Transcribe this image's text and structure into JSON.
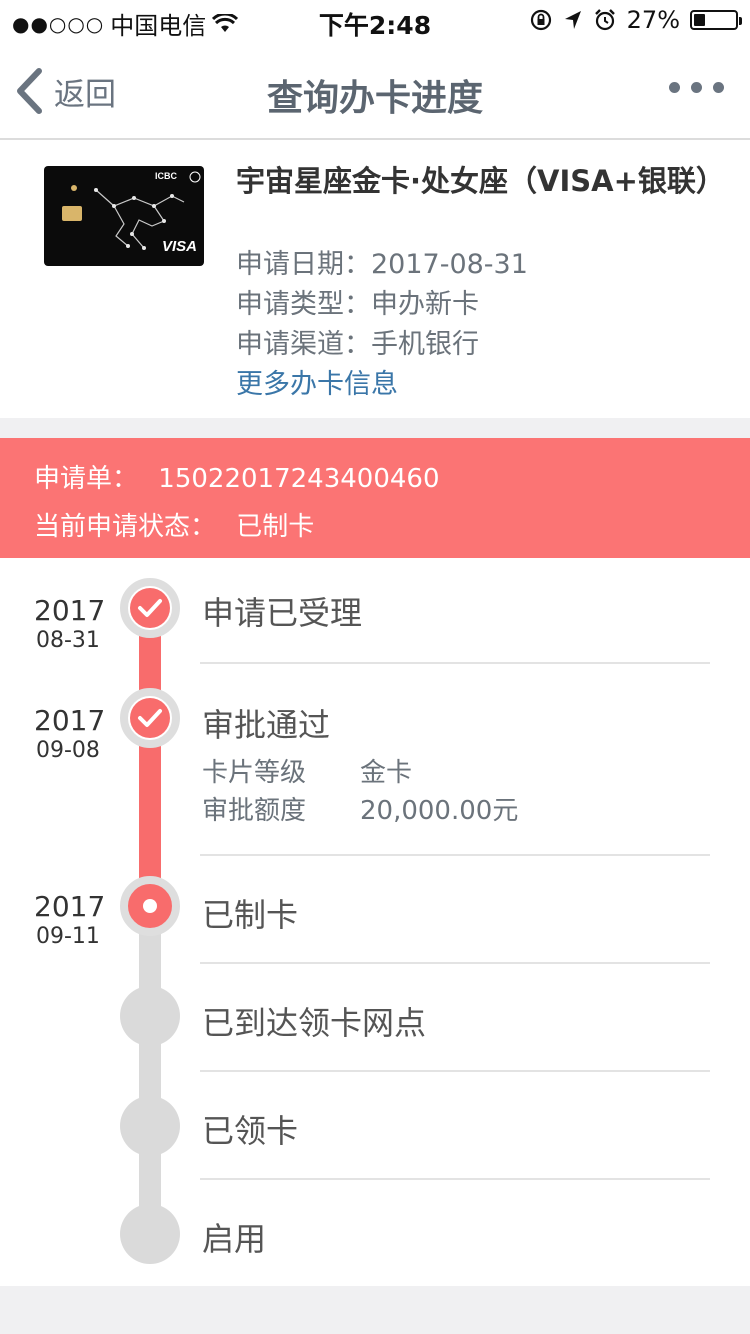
{
  "status_bar": {
    "signal": "●●○○○",
    "carrier": "中国电信",
    "time": "下午2:48",
    "battery_percent": 27,
    "battery_text": "27%"
  },
  "nav": {
    "back_label": "返回",
    "title": "查询办卡进度"
  },
  "card": {
    "title": "宇宙星座金卡·处女座（VISA+银联）",
    "apply_date_label": "申请日期：",
    "apply_date": "2017-08-31",
    "apply_type_label": "申请类型：",
    "apply_type": "申办新卡",
    "apply_channel_label": "申请渠道：",
    "apply_channel": "手机银行",
    "more_info_link": "更多办卡信息",
    "card_bank": "ICBC",
    "card_brand": "VISA"
  },
  "application": {
    "number_label": "申请单：",
    "number": "15022017243400460",
    "status_label": "当前申请状态：",
    "status": "已制卡"
  },
  "timeline": {
    "steps": [
      {
        "label": "申请已受理",
        "year": "2017",
        "day": "08-31",
        "state": "done"
      },
      {
        "label": "审批通过",
        "year": "2017",
        "day": "09-08",
        "state": "done",
        "details": [
          {
            "key": "卡片等级",
            "value": "金卡"
          },
          {
            "key": "审批额度",
            "value": "20,000.00元"
          }
        ]
      },
      {
        "label": "已制卡",
        "year": "2017",
        "day": "09-11",
        "state": "current"
      },
      {
        "label": "已到达领卡网点",
        "year": "",
        "day": "",
        "state": "pending"
      },
      {
        "label": "已领卡",
        "year": "",
        "day": "",
        "state": "pending"
      },
      {
        "label": "启用",
        "year": "",
        "day": "",
        "state": "pending"
      }
    ]
  },
  "colors": {
    "accent": "#fb7474",
    "track_active": "#f86c6c",
    "track_inactive": "#dadada",
    "link": "#3a76a8"
  }
}
